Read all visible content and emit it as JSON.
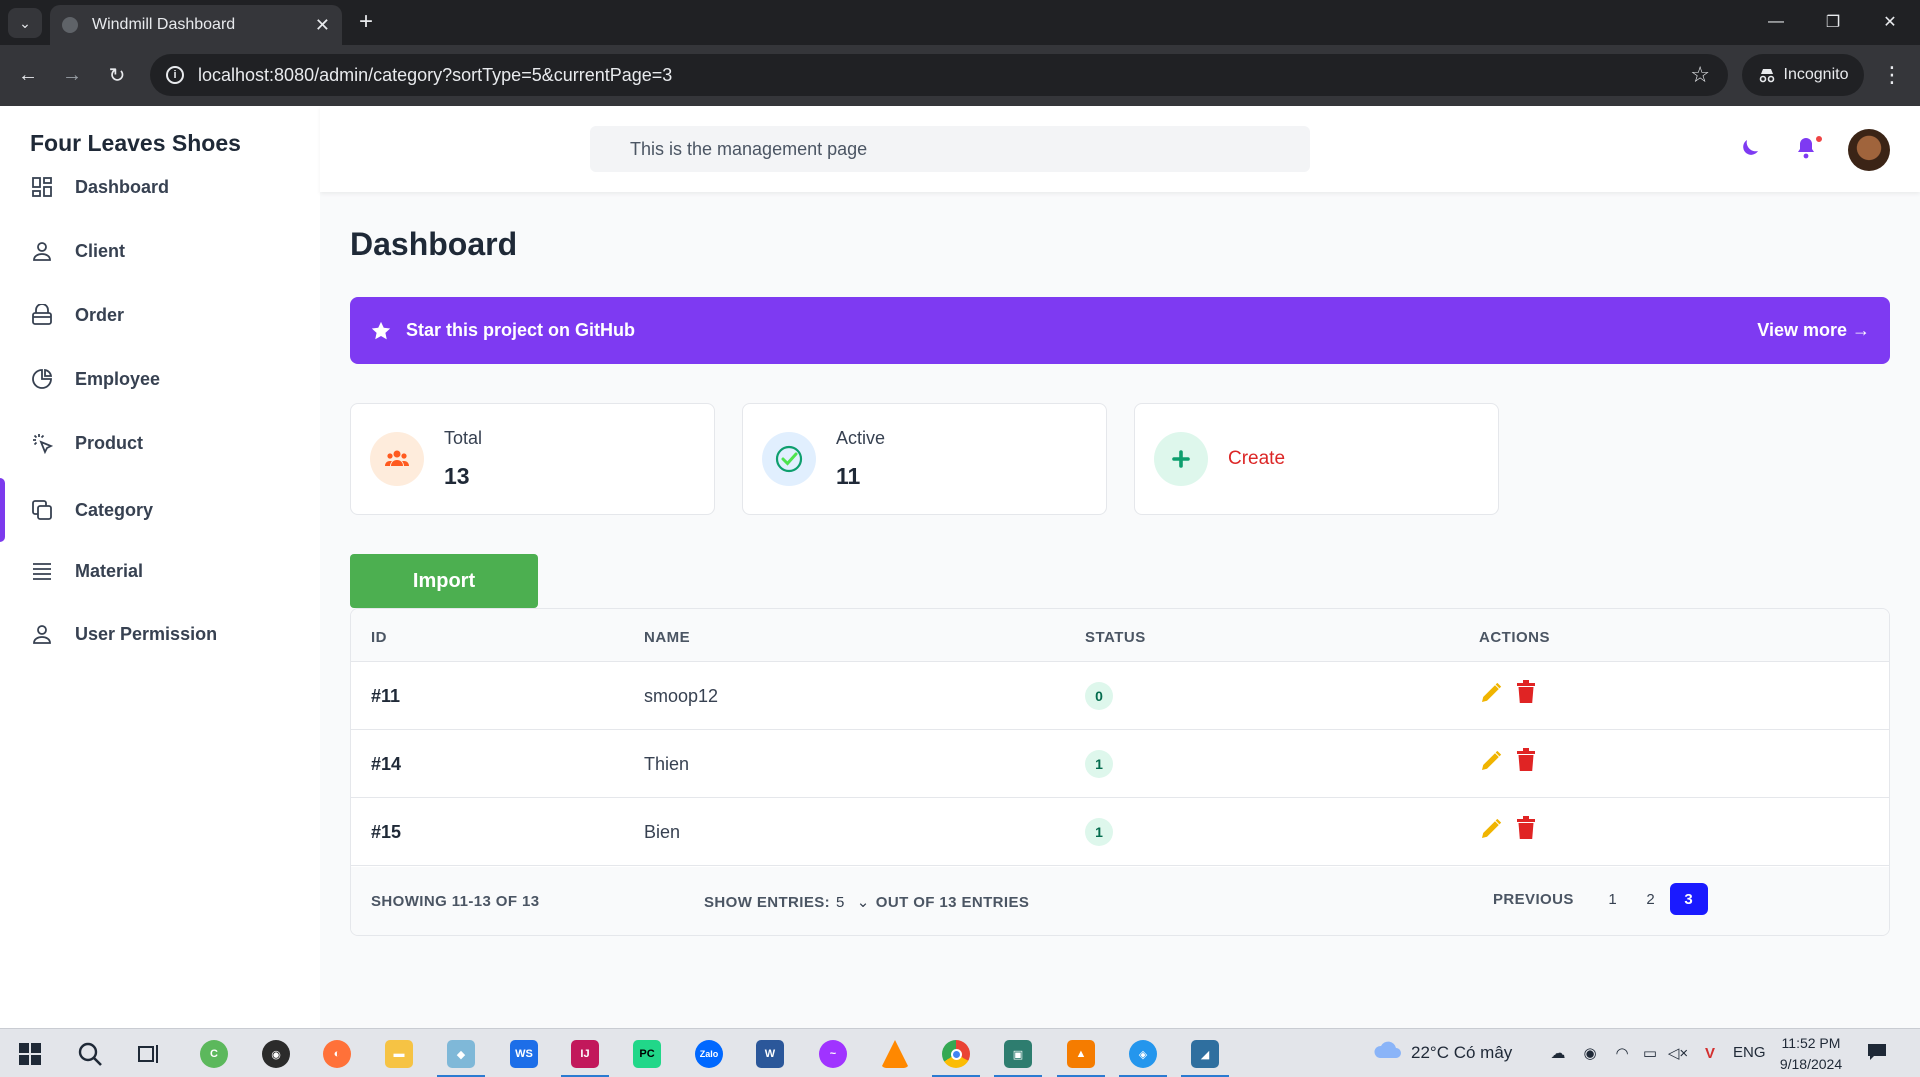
{
  "browser": {
    "tab_title": "Windmill Dashboard",
    "url": "localhost:8080/admin/category?sortType=5&currentPage=3",
    "incognito_label": "Incognito"
  },
  "sidebar": {
    "brand": "Four Leaves Shoes",
    "items": [
      {
        "label": "Dashboard",
        "icon": "dashboard-icon"
      },
      {
        "label": "Client",
        "icon": "user-icon"
      },
      {
        "label": "Order",
        "icon": "basket-icon"
      },
      {
        "label": "Employee",
        "icon": "pie-chart-icon"
      },
      {
        "label": "Product",
        "icon": "cursor-click-icon"
      },
      {
        "label": "Category",
        "icon": "pages-icon",
        "active": true
      },
      {
        "label": "Material",
        "icon": "menu-lines-icon"
      },
      {
        "label": "User Permission",
        "icon": "user-icon"
      }
    ]
  },
  "header": {
    "search_text": "This is the management page"
  },
  "main": {
    "title": "Dashboard",
    "banner": {
      "text": "Star this project on GitHub",
      "link": "View more →"
    },
    "stats": {
      "total_label": "Total",
      "total_value": "13",
      "active_label": "Active",
      "active_value": "11",
      "create_label": "Create"
    },
    "import_label": "Import"
  },
  "table": {
    "headers": {
      "id": "ID",
      "name": "NAME",
      "status": "STATUS",
      "actions": "ACTIONS"
    },
    "rows": [
      {
        "id": "#11",
        "name": "smoop12",
        "status": "0"
      },
      {
        "id": "#14",
        "name": "Thien",
        "status": "1"
      },
      {
        "id": "#15",
        "name": "Bien",
        "status": "1"
      }
    ],
    "footer": {
      "showing": "SHOWING 11-13 OF 13",
      "show_entries": "SHOW ENTRIES:",
      "entries_value": "5",
      "out_of": "OUT OF 13 ENTRIES",
      "previous": "PREVIOUS",
      "pages": [
        "1",
        "2",
        "3"
      ],
      "current_page": "3"
    }
  },
  "taskbar": {
    "weather": "22°C  Có mây",
    "lang": "ENG",
    "time": "11:52 PM",
    "date": "9/18/2024"
  },
  "colors": {
    "accent": "#7e3af2",
    "import_green": "#4caf50",
    "current_page": "#1a1aff",
    "delete_red": "#e02424",
    "edit_yellow": "#f0b400"
  }
}
